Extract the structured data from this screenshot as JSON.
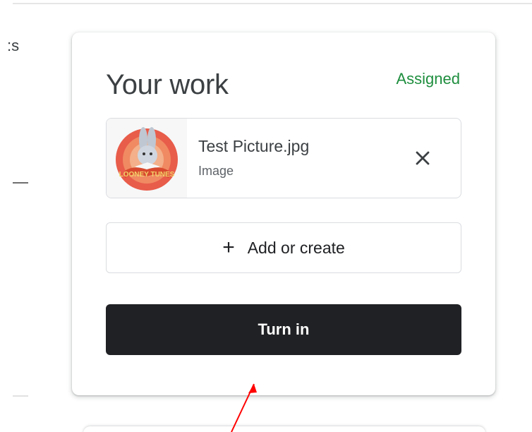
{
  "left_panel": {
    "partial_text": ":s"
  },
  "card": {
    "title": "Your work",
    "status": "Assigned",
    "attachment": {
      "file_name": "Test Picture.jpg",
      "file_type": "Image",
      "thumbnail_text": "LOONEY TUNES"
    },
    "add_button": {
      "label": "Add or create",
      "icon": "plus-icon"
    },
    "turn_in_button": {
      "label": "Turn in"
    }
  },
  "colors": {
    "status": "#1e8e3e",
    "primary_button": "#202124",
    "annotation_arrow": "#ff0000"
  }
}
